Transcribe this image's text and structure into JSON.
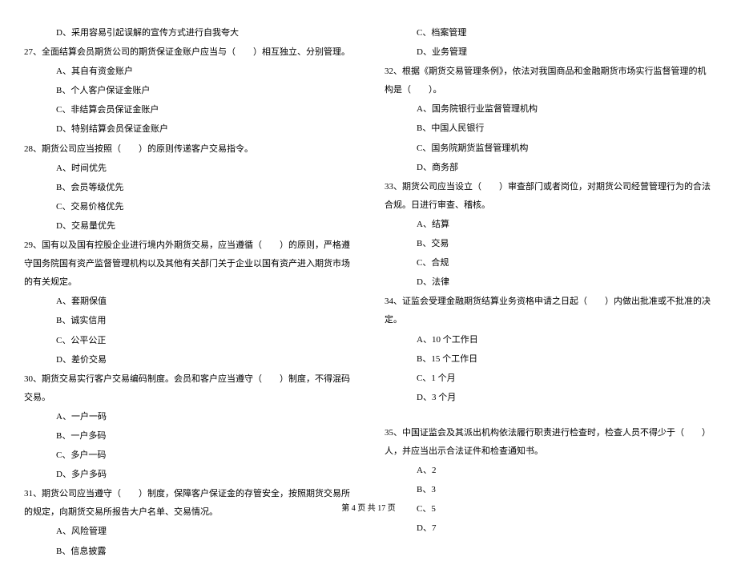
{
  "left_column": [
    {
      "type": "option",
      "text": "D、采用容易引起误解的宣传方式进行自我夸大"
    },
    {
      "type": "question",
      "text": "27、全面结算会员期货公司的期货保证金账户应当与（　　）相互独立、分别管理。"
    },
    {
      "type": "option",
      "text": "A、其自有资金账户"
    },
    {
      "type": "option",
      "text": "B、个人客户保证金账户"
    },
    {
      "type": "option",
      "text": "C、非结算会员保证金账户"
    },
    {
      "type": "option",
      "text": "D、特别结算会员保证金账户"
    },
    {
      "type": "question",
      "text": "28、期货公司应当按照（　　）的原则传递客户交易指令。"
    },
    {
      "type": "option",
      "text": "A、时间优先"
    },
    {
      "type": "option",
      "text": "B、会员等级优先"
    },
    {
      "type": "option",
      "text": "C、交易价格优先"
    },
    {
      "type": "option",
      "text": "D、交易量优先"
    },
    {
      "type": "question",
      "text": "29、国有以及国有控股企业进行境内外期货交易，应当遵循（　　）的原则，严格遵守国务院国有资产监督管理机构以及其他有关部门关于企业以国有资产进入期货市场的有关规定。"
    },
    {
      "type": "option",
      "text": "A、套期保值"
    },
    {
      "type": "option",
      "text": "B、诚实信用"
    },
    {
      "type": "option",
      "text": "C、公平公正"
    },
    {
      "type": "option",
      "text": "D、差价交易"
    },
    {
      "type": "question",
      "text": "30、期货交易实行客户交易编码制度。会员和客户应当遵守（　　）制度，不得混码交易。"
    },
    {
      "type": "option",
      "text": "A、一户一码"
    },
    {
      "type": "option",
      "text": "B、一户多码"
    },
    {
      "type": "option",
      "text": "C、多户一码"
    },
    {
      "type": "option",
      "text": "D、多户多码"
    },
    {
      "type": "question",
      "text": "31、期货公司应当遵守（　　）制度，保障客户保证金的存管安全，按照期货交易所的规定，向期货交易所报告大户名单、交易情况。"
    },
    {
      "type": "option",
      "text": "A、风险管理"
    },
    {
      "type": "option",
      "text": "B、信息披露"
    }
  ],
  "right_column": [
    {
      "type": "option",
      "text": "C、档案管理"
    },
    {
      "type": "option",
      "text": "D、业务管理"
    },
    {
      "type": "question",
      "text": "32、根据《期货交易管理条例》，依法对我国商品和金融期货市场实行监督管理的机构是（　　）。"
    },
    {
      "type": "option",
      "text": "A、国务院银行业监督管理机构"
    },
    {
      "type": "option",
      "text": "B、中国人民银行"
    },
    {
      "type": "option",
      "text": "C、国务院期货监督管理机构"
    },
    {
      "type": "option",
      "text": "D、商务部"
    },
    {
      "type": "question",
      "text": "33、期货公司应当设立（　　）审查部门或者岗位，对期货公司经营管理行为的合法合规。日进行审查、稽核。"
    },
    {
      "type": "option",
      "text": "A、结算"
    },
    {
      "type": "option",
      "text": "B、交易"
    },
    {
      "type": "option",
      "text": "C、合规"
    },
    {
      "type": "option",
      "text": "D、法律"
    },
    {
      "type": "question",
      "text": "34、证监会受理金融期货结算业务资格申请之日起（　　）内做出批准或不批准的决定。"
    },
    {
      "type": "option",
      "text": "A、10 个工作日"
    },
    {
      "type": "option",
      "text": "B、15 个工作日"
    },
    {
      "type": "option",
      "text": "C、1 个月"
    },
    {
      "type": "option",
      "text": "D、3 个月"
    },
    {
      "type": "spacer",
      "text": ""
    },
    {
      "type": "question",
      "text": "35、中国证监会及其派出机构依法履行职责进行检查时，检查人员不得少于（　　）人，并应当出示合法证件和检查通知书。"
    },
    {
      "type": "option",
      "text": "A、2"
    },
    {
      "type": "option",
      "text": "B、3"
    },
    {
      "type": "option",
      "text": "C、5"
    },
    {
      "type": "option",
      "text": "D、7"
    }
  ],
  "footer": "第 4 页 共 17 页"
}
